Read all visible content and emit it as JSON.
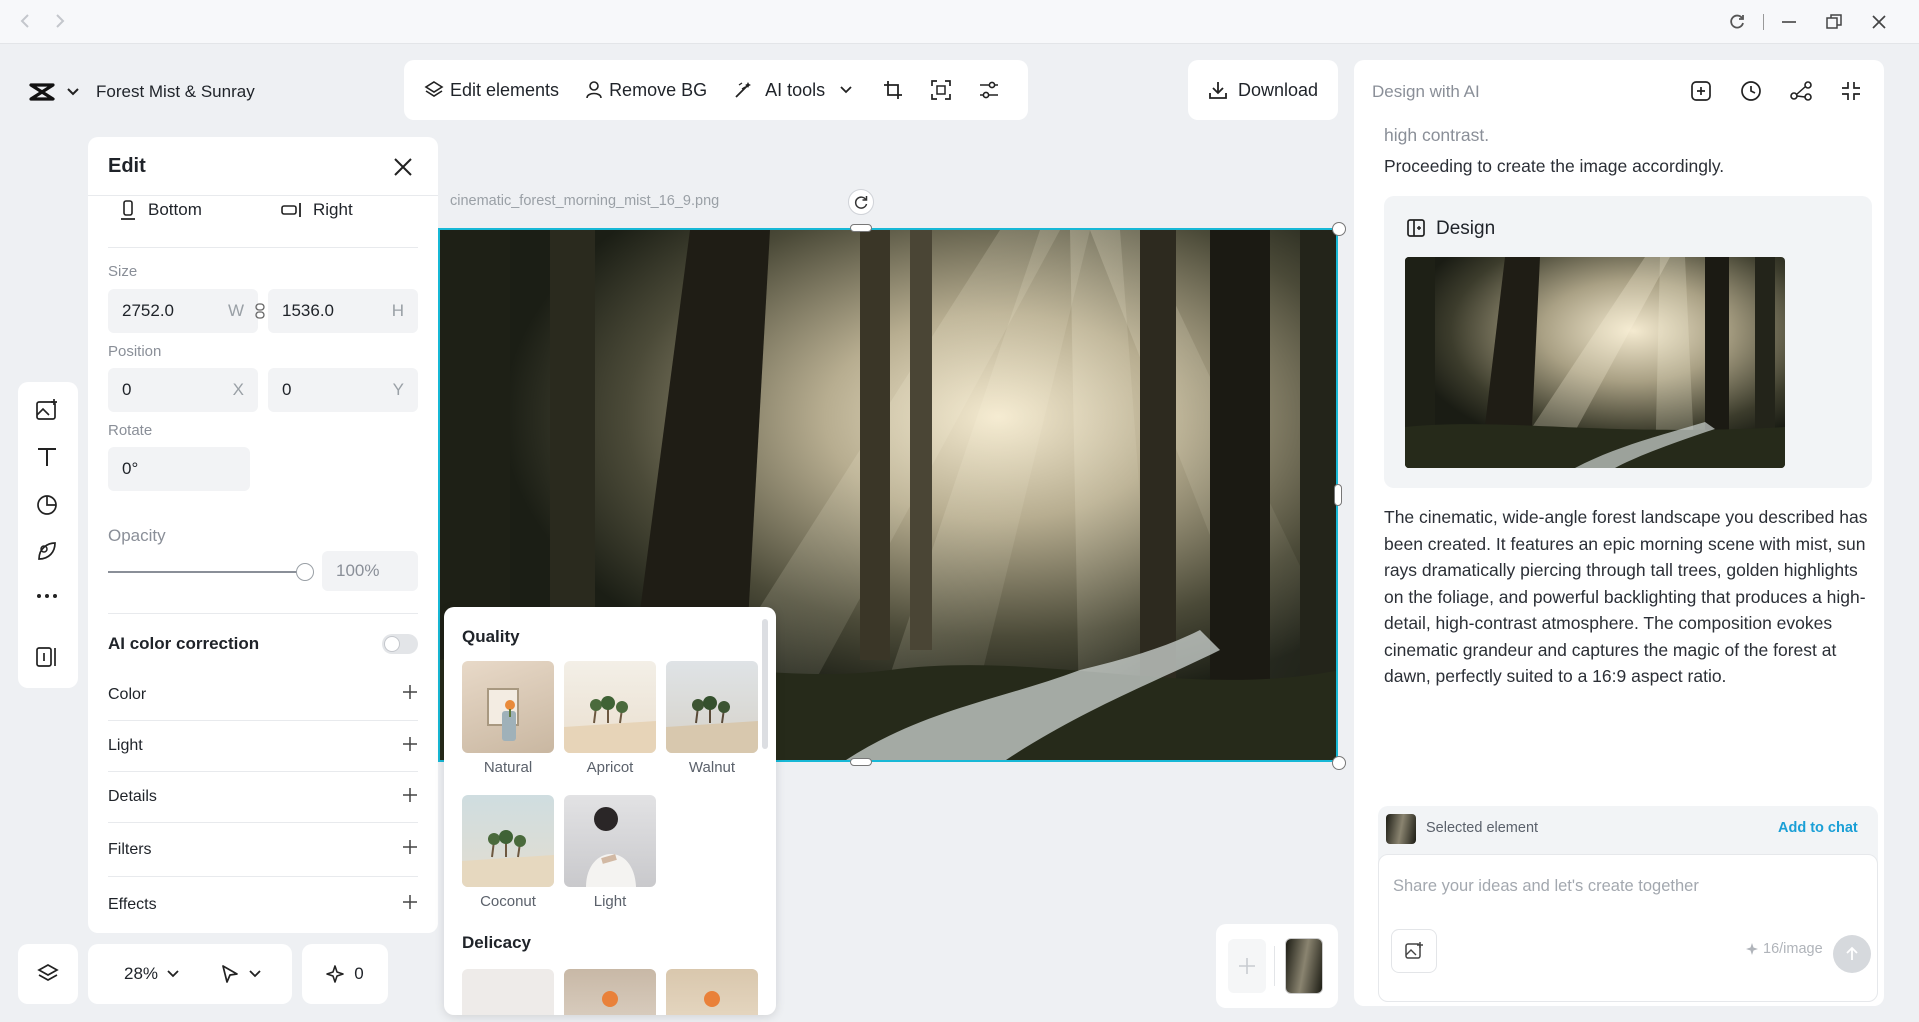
{
  "window": {
    "title": "Forest Mist & Sunray"
  },
  "toolbar": {
    "edit_elements": "Edit elements",
    "remove_bg": "Remove BG",
    "ai_tools": "AI tools",
    "download": "Download"
  },
  "edit_panel": {
    "title": "Edit",
    "align_bottom": "Bottom",
    "align_right": "Right",
    "size_label": "Size",
    "width": "2752.0",
    "width_suffix": "W",
    "height": "1536.0",
    "height_suffix": "H",
    "position_label": "Position",
    "pos_x": "0",
    "pos_x_suffix": "X",
    "pos_y": "0",
    "pos_y_suffix": "Y",
    "rotate_label": "Rotate",
    "rotate": "0°",
    "opacity_label": "Opacity",
    "opacity_value": "100%",
    "opacity_level": 1.0,
    "ai_color_correction": "AI color correction",
    "sections": [
      "Color",
      "Light",
      "Details",
      "Filters",
      "Effects"
    ]
  },
  "canvas": {
    "filename": "cinematic_forest_morning_mist_16_9.png"
  },
  "filter_popup": {
    "quality_title": "Quality",
    "quality_items": [
      "Natural",
      "Apricot",
      "Walnut",
      "Coconut",
      "Light"
    ],
    "delicacy_title": "Delicacy"
  },
  "bottom_bar": {
    "zoom": "28%",
    "credits": "0"
  },
  "ai_panel": {
    "title": "Design with AI",
    "prev_text_partial": "high contrast.",
    "proceeding": "Proceeding to create the image accordingly.",
    "design_card_title": "Design",
    "description": "The cinematic, wide-angle forest landscape you described has been created. It features an epic morning scene with mist, sun rays dramatically piercing through tall trees, golden highlights on the foliage, and powerful backlighting that produces a high-detail, high-contrast atmosphere. The composition evokes cinematic grandeur and captures the magic of the forest at dawn, perfectly suited to a 16:9 aspect ratio.",
    "selected_element": "Selected element",
    "add_to_chat": "Add to chat",
    "input_placeholder": "Share your ideas and let's create together",
    "cost": "16/image"
  },
  "colors": {
    "accent_cyan": "#17b8d6",
    "link_blue": "#1a9fd6"
  }
}
